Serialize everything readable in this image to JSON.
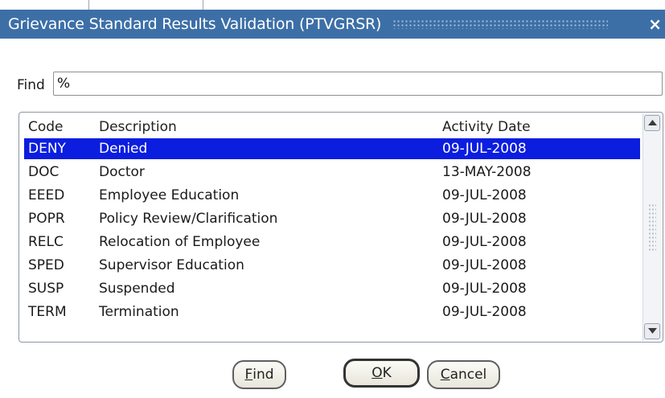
{
  "window": {
    "title": "Grievance Standard Results Validation (PTVGRSR)",
    "close_symbol": "×"
  },
  "find": {
    "label": "Find",
    "value": "%"
  },
  "table": {
    "headers": {
      "code": "Code",
      "description": "Description",
      "activity_date": "Activity Date"
    },
    "selected_index": 0,
    "rows": [
      {
        "code": "DENY",
        "description": "Denied",
        "activity_date": "09-JUL-2008"
      },
      {
        "code": "DOC",
        "description": "Doctor",
        "activity_date": "13-MAY-2008"
      },
      {
        "code": "EEED",
        "description": "Employee Education",
        "activity_date": "09-JUL-2008"
      },
      {
        "code": "POPR",
        "description": "Policy Review/Clarification",
        "activity_date": "09-JUL-2008"
      },
      {
        "code": "RELC",
        "description": "Relocation of Employee",
        "activity_date": "09-JUL-2008"
      },
      {
        "code": "SPED",
        "description": "Supervisor Education",
        "activity_date": "09-JUL-2008"
      },
      {
        "code": "SUSP",
        "description": "Suspended",
        "activity_date": "09-JUL-2008"
      },
      {
        "code": "TERM",
        "description": "Termination",
        "activity_date": "09-JUL-2008"
      }
    ]
  },
  "buttons": {
    "find_mnemonic": "F",
    "find_rest": "ind",
    "ok_mnemonic": "O",
    "ok_rest": "K",
    "cancel_mnemonic": "C",
    "cancel_rest": "ancel"
  },
  "icons": {
    "scroll_up": "triangle-up-icon",
    "scroll_down": "triangle-down-icon"
  },
  "colors": {
    "titlebar": "#3d6fa7",
    "selection": "#0b1ee0"
  }
}
